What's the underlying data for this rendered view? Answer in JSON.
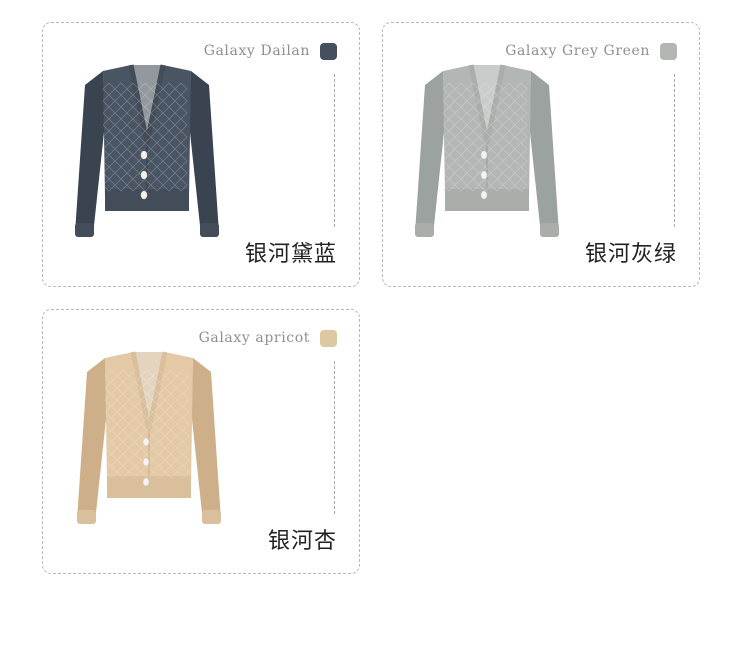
{
  "products": [
    {
      "en": "Galaxy Dailan",
      "zh": "银河黛蓝",
      "swatch_color": "#454f5d",
      "garment_color": "#4a5563",
      "garment_shade": "#3a4350",
      "rib_color": "#434c59"
    },
    {
      "en": "Galaxy Grey Green",
      "zh": "银河灰绿",
      "swatch_color": "#b4b6b3",
      "garment_color": "#b2b7b5",
      "garment_shade": "#9ca29f",
      "rib_color": "#a9aeab"
    },
    {
      "en": "Galaxy apricot",
      "zh": "银河杏",
      "swatch_color": "#ddc8a3",
      "garment_color": "#e3c9a6",
      "garment_shade": "#cdb08a",
      "rib_color": "#d9bf9b"
    }
  ]
}
